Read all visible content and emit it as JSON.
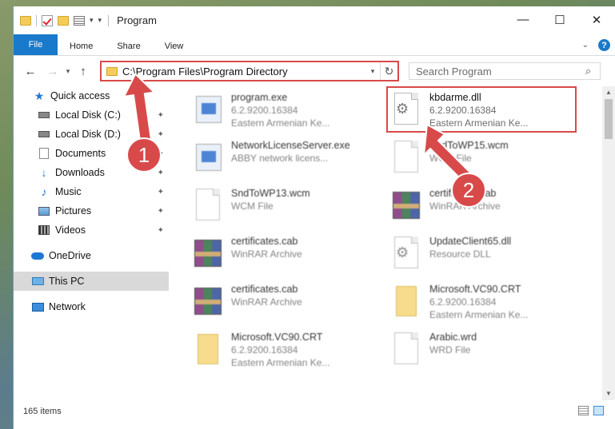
{
  "window": {
    "title": "Program",
    "controls": {
      "minimize": "—",
      "maximize": "☐",
      "close": "✕"
    }
  },
  "ribbon": {
    "tabs": [
      "File",
      "Home",
      "Share",
      "View"
    ]
  },
  "address": {
    "path": "C:\\Program Files\\Program Directory",
    "search_placeholder": "Search Program"
  },
  "sidebar": {
    "items": [
      {
        "label": "Quick access",
        "icon": "star-icon"
      },
      {
        "label": "Local Disk (C:)",
        "icon": "disk-icon",
        "pinned": true
      },
      {
        "label": "Local Disk (D:)",
        "icon": "disk-icon",
        "pinned": true
      },
      {
        "label": "Documents",
        "icon": "documents-icon",
        "pinned": true
      },
      {
        "label": "Downloads",
        "icon": "download-icon",
        "pinned": true
      },
      {
        "label": "Music",
        "icon": "music-icon",
        "pinned": true
      },
      {
        "label": "Pictures",
        "icon": "pictures-icon",
        "pinned": true
      },
      {
        "label": "Videos",
        "icon": "videos-icon",
        "pinned": true
      },
      {
        "label": "OneDrive",
        "icon": "onedrive-icon"
      },
      {
        "label": "This PC",
        "icon": "pc-icon",
        "selected": true
      },
      {
        "label": "Network",
        "icon": "network-icon"
      }
    ]
  },
  "files": [
    {
      "name": "program.exe",
      "line2": "6.2.9200.16384",
      "line3": "Eastern Armenian Ke...",
      "icon": "exe-icon"
    },
    {
      "name": "kbdarme.dll",
      "line2": "6.2.9200.16384",
      "line3": "Eastern Armenian Ke...",
      "icon": "dll-icon",
      "highlighted": true
    },
    {
      "name": "NetworkLicenseServer.exe",
      "line2": "ABBY network licens...",
      "line3": "",
      "icon": "exe-icon"
    },
    {
      "name": "SndToWP15.wcm",
      "line2": "WCM File",
      "line3": "",
      "icon": "file-icon"
    },
    {
      "name": "SndToWP13.wcm",
      "line2": "WCM File",
      "line3": "",
      "icon": "file-icon"
    },
    {
      "name": "certificates.cab",
      "line2": "WinRAR Archive",
      "line3": "",
      "icon": "archive-icon"
    },
    {
      "name": "certificates.cab",
      "line2": "WinRAR Archive",
      "line3": "",
      "icon": "archive-icon"
    },
    {
      "name": "UpdateClient65.dll",
      "line2": "Resource DLL",
      "line3": "",
      "icon": "dll-icon"
    },
    {
      "name": "certificates.cab",
      "line2": "WinRAR Archive",
      "line3": "",
      "icon": "archive-icon"
    },
    {
      "name": "Microsoft.VC90.CRT",
      "line2": "6.2.9200.16384",
      "line3": "Eastern Armenian Ke...",
      "icon": "manifest-icon"
    },
    {
      "name": "Microsoft.VC90.CRT",
      "line2": "6.2.9200.16384",
      "line3": "Eastern Armenian Ke...",
      "icon": "manifest-icon"
    },
    {
      "name": "Arabic.wrd",
      "line2": "WRD File",
      "line3": "",
      "icon": "file-icon"
    }
  ],
  "status": {
    "count": "165 items"
  },
  "annotations": {
    "badge1": "1",
    "badge2": "2"
  },
  "colors": {
    "accent": "#1979ca",
    "highlight": "#d84a4a"
  }
}
